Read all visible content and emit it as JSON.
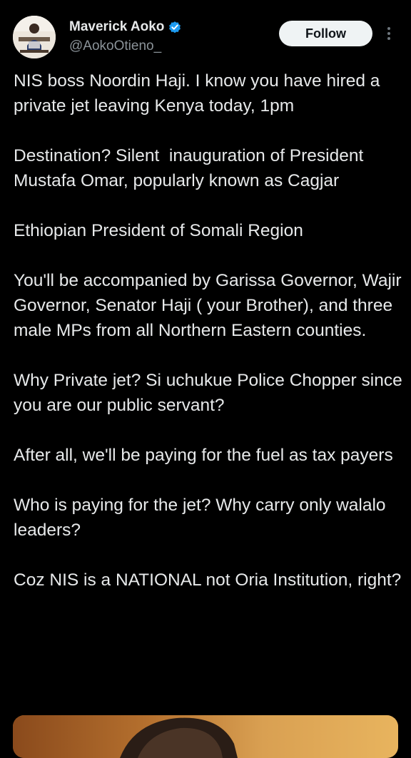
{
  "author": {
    "display_name": "Maverick Aoko",
    "handle": "@AokoOtieno_",
    "verified": true,
    "verified_color": "#1d9bf0"
  },
  "actions": {
    "follow_label": "Follow",
    "more_icon": "more-vertical-icon"
  },
  "tweet": {
    "paragraphs": [
      "NIS boss Noordin Haji. I know you have hired a private jet leaving Kenya today, 1pm",
      "Destination? Silent  inauguration of President Mustafa Omar, popularly known as Cagjar",
      "Ethiopian President of Somali Region",
      "You'll be accompanied by Garissa Governor, Wajir Governor, Senator Haji ( your Brother), and three male MPs from all Northern Eastern counties.",
      "Why Private jet? Si uchukue Police Chopper since you are our public servant?",
      "After all, we'll be paying for the fuel as tax payers",
      "Who is paying for the jet? Why carry only walalo leaders?",
      "Coz NIS is a NATIONAL not Oria Institution, right?"
    ]
  },
  "theme": {
    "background": "#000000",
    "text": "#e7e9ea",
    "secondary_text": "#8b9399",
    "follow_bg": "#eff3f4"
  }
}
